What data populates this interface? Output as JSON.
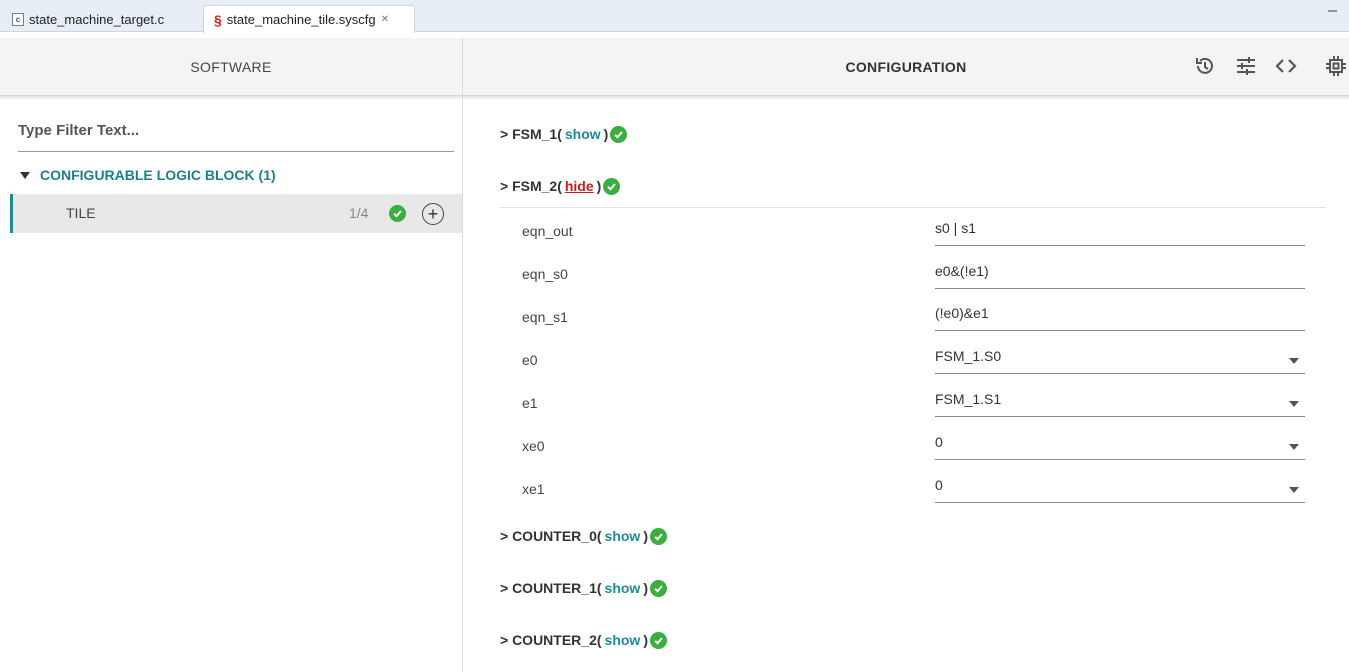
{
  "tabs": [
    {
      "label": "state_machine_target.c",
      "icon": "c-file-icon",
      "active": false
    },
    {
      "label": "state_machine_tile.syscfg",
      "icon": "syscfg-icon",
      "active": true
    }
  ],
  "header": {
    "left_title": "SOFTWARE",
    "right_title": "CONFIGURATION",
    "icons": [
      "history-icon",
      "settings-sliders-icon",
      "code-view-icon",
      "chip-icon"
    ]
  },
  "sidebar": {
    "filter_text": "Type Filter Text...",
    "category": "CONFIGURABLE LOGIC BLOCK (1)",
    "item": {
      "label": "TILE",
      "count": "1/4"
    }
  },
  "config": {
    "groups": [
      {
        "name": "> FSM_1(",
        "toggle": "show",
        "close": ")"
      },
      {
        "name": "> FSM_2(",
        "toggle": "hide",
        "close": ")"
      },
      {
        "name": "> COUNTER_0(",
        "toggle": "show",
        "close": ")"
      },
      {
        "name": "> COUNTER_1(",
        "toggle": "show",
        "close": ")"
      },
      {
        "name": "> COUNTER_2(",
        "toggle": "show",
        "close": ")"
      }
    ],
    "properties": [
      {
        "label": "eqn_out",
        "value": "s0 | s1"
      },
      {
        "label": "eqn_s0",
        "value": "e0&(!e1)"
      },
      {
        "label": "eqn_s1",
        "value": "(!e0)&e1"
      },
      {
        "label": "e0",
        "value": "FSM_1.S0"
      },
      {
        "label": "e1",
        "value": "FSM_1.S1"
      },
      {
        "label": "xe0",
        "value": "0"
      },
      {
        "label": "xe1",
        "value": "0"
      }
    ]
  },
  "colors": {
    "accent": "#1d8a98",
    "hide_link": "#cc1b1b",
    "ok": "#3aae3f"
  }
}
